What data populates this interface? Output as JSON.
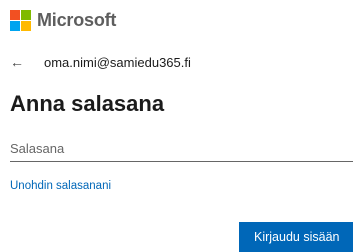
{
  "brand": {
    "name": "Microsoft",
    "logo_colors": [
      "#f25022",
      "#7fba00",
      "#00a4ef",
      "#ffb900"
    ]
  },
  "identity": {
    "back_icon": "back-arrow-icon",
    "email": "oma.nimi@samiedu365.fi"
  },
  "title": "Anna salasana",
  "password": {
    "placeholder": "Salasana",
    "value": ""
  },
  "forgot_link": "Unohdin salasanani",
  "sign_in_button": "Kirjaudu sisään",
  "colors": {
    "accent": "#0067b8",
    "text": "#1b1b1b",
    "muted": "#666666"
  }
}
